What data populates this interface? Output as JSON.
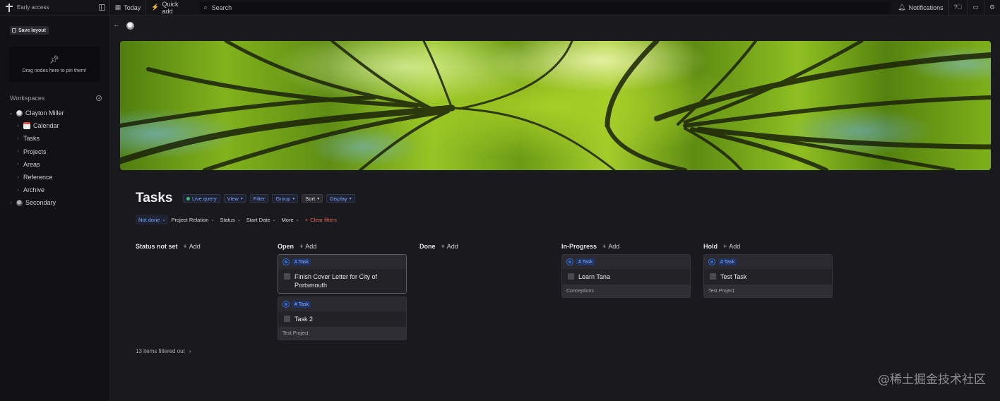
{
  "topbar": {
    "brand": "Early access",
    "today": "Today",
    "quick_add": "Quick add",
    "search_placeholder": "Search",
    "notifications": "Notifications"
  },
  "sidebar": {
    "save_layout": "Save layout",
    "pin_hint": "Drag nodes here to pin them!",
    "workspaces_title": "Workspaces",
    "items": [
      {
        "label": "Clayton Miller"
      },
      {
        "label": "Calendar"
      },
      {
        "label": "Tasks"
      },
      {
        "label": "Projects"
      },
      {
        "label": "Areas"
      },
      {
        "label": "Reference"
      },
      {
        "label": "Archive"
      },
      {
        "label": "Secondary"
      }
    ]
  },
  "page": {
    "title": "Tasks",
    "chips": [
      "Live query",
      "View",
      "Filter",
      "Group",
      "Sort",
      "Display"
    ],
    "filters": [
      "Not done",
      "Project Relation",
      "Status",
      "Start Date",
      "More",
      "Clear filters"
    ],
    "filtered_out": "13 items filtered out"
  },
  "board": {
    "add_label": "Add",
    "tag_label": "# Task",
    "columns": [
      {
        "title": "Status not set",
        "cards": []
      },
      {
        "title": "Open",
        "cards": [
          {
            "title": "Finish Cover Letter for City of Portsmouth",
            "footer": ""
          },
          {
            "title": "Task 2",
            "footer": "Test Project"
          }
        ]
      },
      {
        "title": "Done",
        "cards": []
      },
      {
        "title": "In-Progress",
        "cards": [
          {
            "title": "Learn Tana",
            "footer": "Conceptions"
          }
        ]
      },
      {
        "title": "Hold",
        "cards": [
          {
            "title": "Test Task",
            "footer": "Test Project"
          }
        ]
      }
    ]
  },
  "watermark": "@稀土掘金技术社区",
  "colors": {
    "accent": "#2f6de5",
    "clear_filter": "#e0625a",
    "live_dot": "#3fb979"
  }
}
